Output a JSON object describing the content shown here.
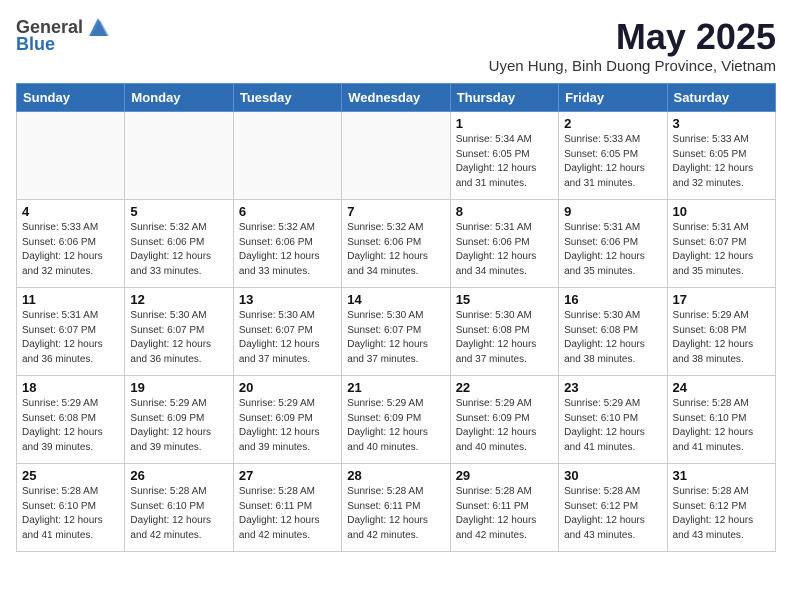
{
  "header": {
    "logo_general": "General",
    "logo_blue": "Blue",
    "title": "May 2025",
    "subtitle": "Uyen Hung, Binh Duong Province, Vietnam"
  },
  "days_of_week": [
    "Sunday",
    "Monday",
    "Tuesday",
    "Wednesday",
    "Thursday",
    "Friday",
    "Saturday"
  ],
  "weeks": [
    [
      {
        "day": "",
        "info": ""
      },
      {
        "day": "",
        "info": ""
      },
      {
        "day": "",
        "info": ""
      },
      {
        "day": "",
        "info": ""
      },
      {
        "day": "1",
        "info": "Sunrise: 5:34 AM\nSunset: 6:05 PM\nDaylight: 12 hours\nand 31 minutes."
      },
      {
        "day": "2",
        "info": "Sunrise: 5:33 AM\nSunset: 6:05 PM\nDaylight: 12 hours\nand 31 minutes."
      },
      {
        "day": "3",
        "info": "Sunrise: 5:33 AM\nSunset: 6:05 PM\nDaylight: 12 hours\nand 32 minutes."
      }
    ],
    [
      {
        "day": "4",
        "info": "Sunrise: 5:33 AM\nSunset: 6:06 PM\nDaylight: 12 hours\nand 32 minutes."
      },
      {
        "day": "5",
        "info": "Sunrise: 5:32 AM\nSunset: 6:06 PM\nDaylight: 12 hours\nand 33 minutes."
      },
      {
        "day": "6",
        "info": "Sunrise: 5:32 AM\nSunset: 6:06 PM\nDaylight: 12 hours\nand 33 minutes."
      },
      {
        "day": "7",
        "info": "Sunrise: 5:32 AM\nSunset: 6:06 PM\nDaylight: 12 hours\nand 34 minutes."
      },
      {
        "day": "8",
        "info": "Sunrise: 5:31 AM\nSunset: 6:06 PM\nDaylight: 12 hours\nand 34 minutes."
      },
      {
        "day": "9",
        "info": "Sunrise: 5:31 AM\nSunset: 6:06 PM\nDaylight: 12 hours\nand 35 minutes."
      },
      {
        "day": "10",
        "info": "Sunrise: 5:31 AM\nSunset: 6:07 PM\nDaylight: 12 hours\nand 35 minutes."
      }
    ],
    [
      {
        "day": "11",
        "info": "Sunrise: 5:31 AM\nSunset: 6:07 PM\nDaylight: 12 hours\nand 36 minutes."
      },
      {
        "day": "12",
        "info": "Sunrise: 5:30 AM\nSunset: 6:07 PM\nDaylight: 12 hours\nand 36 minutes."
      },
      {
        "day": "13",
        "info": "Sunrise: 5:30 AM\nSunset: 6:07 PM\nDaylight: 12 hours\nand 37 minutes."
      },
      {
        "day": "14",
        "info": "Sunrise: 5:30 AM\nSunset: 6:07 PM\nDaylight: 12 hours\nand 37 minutes."
      },
      {
        "day": "15",
        "info": "Sunrise: 5:30 AM\nSunset: 6:08 PM\nDaylight: 12 hours\nand 37 minutes."
      },
      {
        "day": "16",
        "info": "Sunrise: 5:30 AM\nSunset: 6:08 PM\nDaylight: 12 hours\nand 38 minutes."
      },
      {
        "day": "17",
        "info": "Sunrise: 5:29 AM\nSunset: 6:08 PM\nDaylight: 12 hours\nand 38 minutes."
      }
    ],
    [
      {
        "day": "18",
        "info": "Sunrise: 5:29 AM\nSunset: 6:08 PM\nDaylight: 12 hours\nand 39 minutes."
      },
      {
        "day": "19",
        "info": "Sunrise: 5:29 AM\nSunset: 6:09 PM\nDaylight: 12 hours\nand 39 minutes."
      },
      {
        "day": "20",
        "info": "Sunrise: 5:29 AM\nSunset: 6:09 PM\nDaylight: 12 hours\nand 39 minutes."
      },
      {
        "day": "21",
        "info": "Sunrise: 5:29 AM\nSunset: 6:09 PM\nDaylight: 12 hours\nand 40 minutes."
      },
      {
        "day": "22",
        "info": "Sunrise: 5:29 AM\nSunset: 6:09 PM\nDaylight: 12 hours\nand 40 minutes."
      },
      {
        "day": "23",
        "info": "Sunrise: 5:29 AM\nSunset: 6:10 PM\nDaylight: 12 hours\nand 41 minutes."
      },
      {
        "day": "24",
        "info": "Sunrise: 5:28 AM\nSunset: 6:10 PM\nDaylight: 12 hours\nand 41 minutes."
      }
    ],
    [
      {
        "day": "25",
        "info": "Sunrise: 5:28 AM\nSunset: 6:10 PM\nDaylight: 12 hours\nand 41 minutes."
      },
      {
        "day": "26",
        "info": "Sunrise: 5:28 AM\nSunset: 6:10 PM\nDaylight: 12 hours\nand 42 minutes."
      },
      {
        "day": "27",
        "info": "Sunrise: 5:28 AM\nSunset: 6:11 PM\nDaylight: 12 hours\nand 42 minutes."
      },
      {
        "day": "28",
        "info": "Sunrise: 5:28 AM\nSunset: 6:11 PM\nDaylight: 12 hours\nand 42 minutes."
      },
      {
        "day": "29",
        "info": "Sunrise: 5:28 AM\nSunset: 6:11 PM\nDaylight: 12 hours\nand 42 minutes."
      },
      {
        "day": "30",
        "info": "Sunrise: 5:28 AM\nSunset: 6:12 PM\nDaylight: 12 hours\nand 43 minutes."
      },
      {
        "day": "31",
        "info": "Sunrise: 5:28 AM\nSunset: 6:12 PM\nDaylight: 12 hours\nand 43 minutes."
      }
    ]
  ]
}
